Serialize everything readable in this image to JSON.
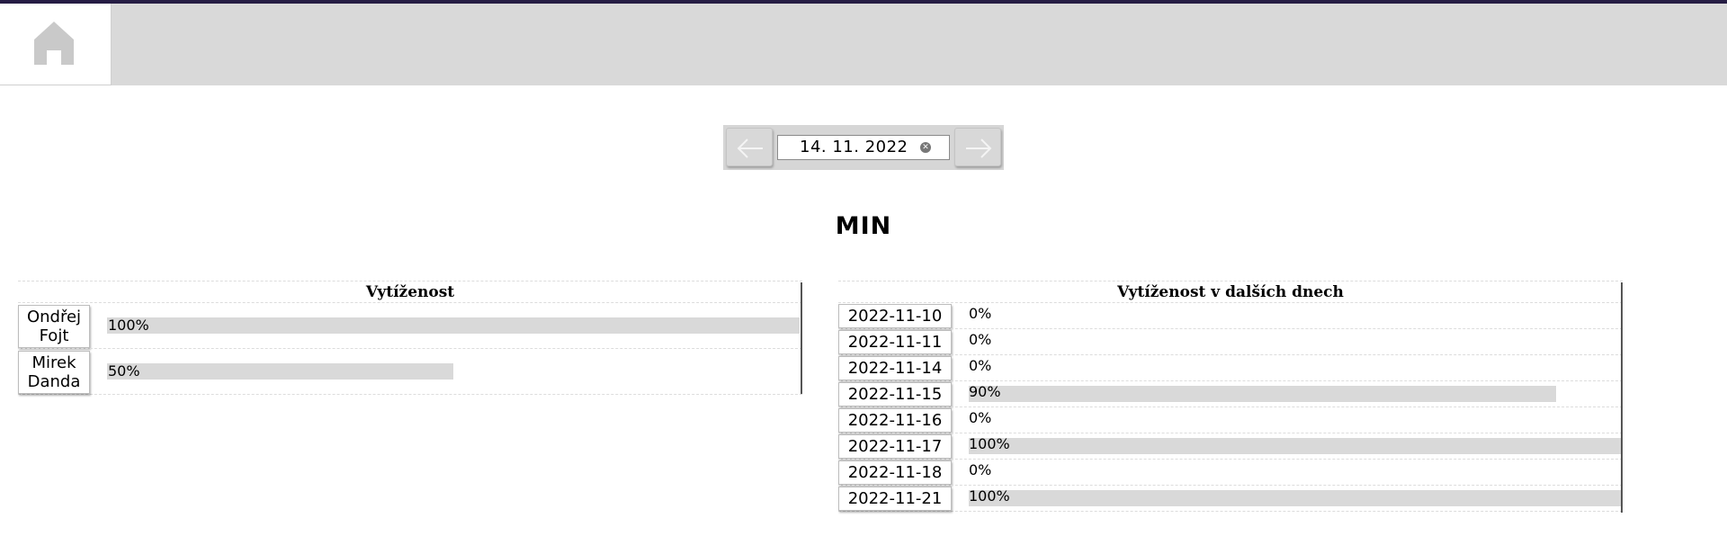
{
  "date_nav": {
    "date_value": "14. 11. 2022"
  },
  "page_title": "MIN",
  "workload": {
    "title": "Vytíženost",
    "rows": [
      {
        "name": "Ondřej Fojt",
        "percent_label": "100%",
        "percent": 100
      },
      {
        "name": "Mirek Danda",
        "percent_label": "50%",
        "percent": 50
      }
    ]
  },
  "upcoming": {
    "title": "Vytíženost v dalších dnech",
    "rows": [
      {
        "date": "2022-11-10",
        "percent_label": "0%",
        "percent": 0
      },
      {
        "date": "2022-11-11",
        "percent_label": "0%",
        "percent": 0
      },
      {
        "date": "2022-11-14",
        "percent_label": "0%",
        "percent": 0
      },
      {
        "date": "2022-11-15",
        "percent_label": "90%",
        "percent": 90
      },
      {
        "date": "2022-11-16",
        "percent_label": "0%",
        "percent": 0
      },
      {
        "date": "2022-11-17",
        "percent_label": "100%",
        "percent": 100
      },
      {
        "date": "2022-11-18",
        "percent_label": "0%",
        "percent": 0
      },
      {
        "date": "2022-11-21",
        "percent_label": "100%",
        "percent": 100
      }
    ]
  }
}
